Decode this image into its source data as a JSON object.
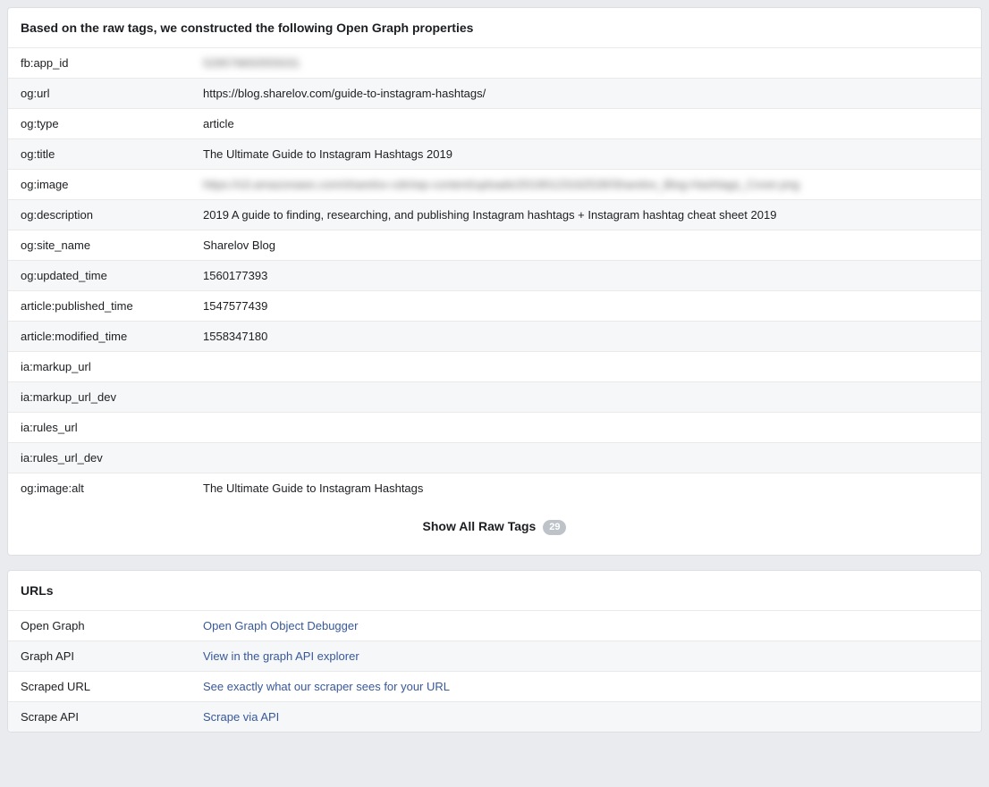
{
  "og_panel": {
    "header": "Based on the raw tags, we constructed the following Open Graph properties",
    "rows": [
      {
        "key": "fb:app_id",
        "value": "529579650555031",
        "blurred": true
      },
      {
        "key": "og:url",
        "value": "https://blog.sharelov.com/guide-to-instagram-hashtags/"
      },
      {
        "key": "og:type",
        "value": "article"
      },
      {
        "key": "og:title",
        "value": "The Ultimate Guide to Instagram Hashtags 2019"
      },
      {
        "key": "og:image",
        "value": "https://s3.amazonaws.com/sharelov-cdn/wp-content/uploads/20190123162528/Sharelov_Blog-Hashtags_Cover.png",
        "blurred": true
      },
      {
        "key": "og:description",
        "value": "2019 A guide to finding, researching, and publishing Instagram hashtags + Instagram hashtag cheat sheet 2019"
      },
      {
        "key": "og:site_name",
        "value": "Sharelov Blog"
      },
      {
        "key": "og:updated_time",
        "value": "1560177393"
      },
      {
        "key": "article:published_time",
        "value": "1547577439"
      },
      {
        "key": "article:modified_time",
        "value": "1558347180"
      },
      {
        "key": "ia:markup_url",
        "value": ""
      },
      {
        "key": "ia:markup_url_dev",
        "value": ""
      },
      {
        "key": "ia:rules_url",
        "value": ""
      },
      {
        "key": "ia:rules_url_dev",
        "value": ""
      },
      {
        "key": "og:image:alt",
        "value": "The Ultimate Guide to Instagram Hashtags"
      }
    ],
    "show_all_label": "Show All Raw Tags",
    "show_all_count": "29"
  },
  "urls_panel": {
    "header": "URLs",
    "rows": [
      {
        "key": "Open Graph",
        "link_text": "Open Graph Object Debugger"
      },
      {
        "key": "Graph API",
        "link_text": "View in the graph API explorer"
      },
      {
        "key": "Scraped URL",
        "link_text": "See exactly what our scraper sees for your URL"
      },
      {
        "key": "Scrape API",
        "link_text": "Scrape via API"
      }
    ]
  }
}
